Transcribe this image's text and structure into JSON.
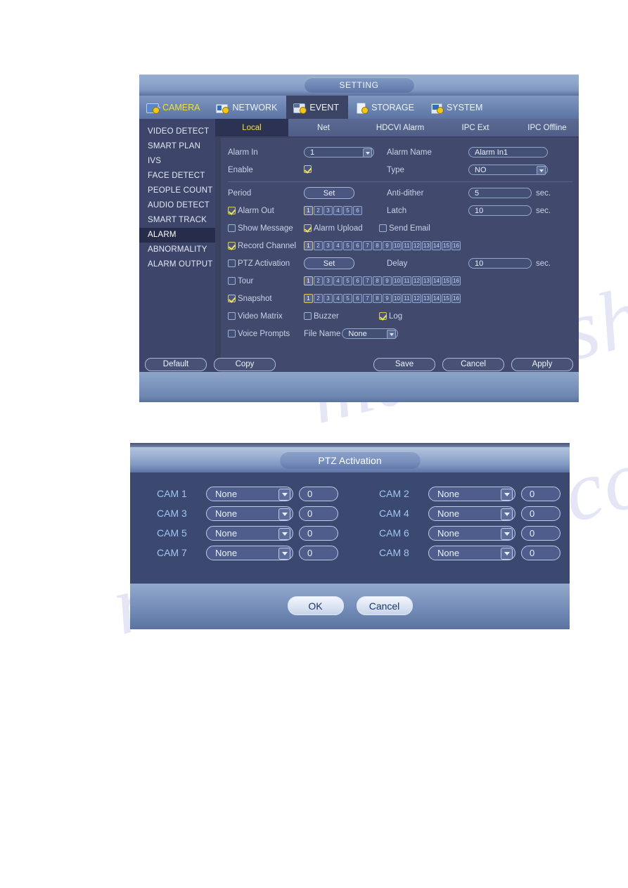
{
  "setting_window": {
    "title": "SETTING",
    "main_tabs": [
      {
        "label": "CAMERA",
        "icon": "camera-icon",
        "state": "hover"
      },
      {
        "label": "NETWORK",
        "icon": "network-icon",
        "state": "normal"
      },
      {
        "label": "EVENT",
        "icon": "event-icon",
        "state": "active"
      },
      {
        "label": "STORAGE",
        "icon": "storage-icon",
        "state": "normal"
      },
      {
        "label": "SYSTEM",
        "icon": "system-icon",
        "state": "normal"
      }
    ],
    "sidebar": {
      "items": [
        {
          "label": "VIDEO DETECT",
          "active": false
        },
        {
          "label": "SMART PLAN",
          "active": false
        },
        {
          "label": "IVS",
          "active": false
        },
        {
          "label": "FACE DETECT",
          "active": false
        },
        {
          "label": "PEOPLE COUNT",
          "active": false
        },
        {
          "label": "AUDIO DETECT",
          "active": false
        },
        {
          "label": "SMART TRACK",
          "active": false
        },
        {
          "label": "ALARM",
          "active": true
        },
        {
          "label": "ABNORMALITY",
          "active": false
        },
        {
          "label": "ALARM OUTPUT",
          "active": false
        }
      ]
    },
    "sub_tabs": [
      {
        "label": "Local",
        "active": true
      },
      {
        "label": "Net",
        "active": false
      },
      {
        "label": "HDCVI Alarm",
        "active": false
      },
      {
        "label": "IPC Ext",
        "active": false
      },
      {
        "label": "IPC Offline",
        "active": false
      }
    ],
    "form": {
      "alarm_in_label": "Alarm In",
      "alarm_in_value": "1",
      "alarm_name_label": "Alarm Name",
      "alarm_name_value": "Alarm In1",
      "enable_label": "Enable",
      "enable_checked": true,
      "type_label": "Type",
      "type_value": "NO",
      "period_label": "Period",
      "period_button": "Set",
      "anti_dither_label": "Anti-dither",
      "anti_dither_value": "5",
      "anti_dither_unit": "sec.",
      "alarm_out_label": "Alarm Out",
      "alarm_out_checked": true,
      "alarm_out_channels": [
        "1",
        "2",
        "3",
        "4",
        "5",
        "6"
      ],
      "alarm_out_selected": [
        "1"
      ],
      "latch_label": "Latch",
      "latch_value": "10",
      "latch_unit": "sec.",
      "show_message_label": "Show Message",
      "show_message_checked": false,
      "alarm_upload_label": "Alarm Upload",
      "alarm_upload_checked": true,
      "send_email_label": "Send Email",
      "send_email_checked": false,
      "record_channel_label": "Record Channel",
      "record_channel_checked": true,
      "record_channels": [
        "1",
        "2",
        "3",
        "4",
        "5",
        "6",
        "7",
        "8",
        "9",
        "10",
        "11",
        "12",
        "13",
        "14",
        "15",
        "16"
      ],
      "record_channels_selected": [
        "1"
      ],
      "ptz_activation_label": "PTZ Activation",
      "ptz_activation_checked": false,
      "ptz_button": "Set",
      "delay_label": "Delay",
      "delay_value": "10",
      "delay_unit": "sec.",
      "tour_label": "Tour",
      "tour_checked": false,
      "tour_channels": [
        "1",
        "2",
        "3",
        "4",
        "5",
        "6",
        "7",
        "8",
        "9",
        "10",
        "11",
        "12",
        "13",
        "14",
        "15",
        "16"
      ],
      "tour_channels_selected": [
        "1"
      ],
      "snapshot_label": "Snapshot",
      "snapshot_checked": true,
      "snapshot_channels": [
        "1",
        "2",
        "3",
        "4",
        "5",
        "6",
        "7",
        "8",
        "9",
        "10",
        "11",
        "12",
        "13",
        "14",
        "15",
        "16"
      ],
      "snapshot_channels_selected": [
        "1"
      ],
      "video_matrix_label": "Video Matrix",
      "video_matrix_checked": false,
      "buzzer_label": "Buzzer",
      "buzzer_checked": false,
      "log_label": "Log",
      "log_checked": true,
      "voice_prompts_label": "Voice Prompts",
      "voice_prompts_checked": false,
      "file_name_label": "File Name",
      "file_name_value": "None"
    },
    "buttons": {
      "default": "Default",
      "copy": "Copy",
      "save": "Save",
      "cancel": "Cancel",
      "apply": "Apply"
    }
  },
  "ptz_window": {
    "title": "PTZ Activation",
    "rows": [
      {
        "left_cam": "CAM 1",
        "left_action": "None",
        "left_value": "0",
        "right_cam": "CAM 2",
        "right_action": "None",
        "right_value": "0"
      },
      {
        "left_cam": "CAM 3",
        "left_action": "None",
        "left_value": "0",
        "right_cam": "CAM 4",
        "right_action": "None",
        "right_value": "0"
      },
      {
        "left_cam": "CAM 5",
        "left_action": "None",
        "left_value": "0",
        "right_cam": "CAM 6",
        "right_action": "None",
        "right_value": "0"
      },
      {
        "left_cam": "CAM 7",
        "left_action": "None",
        "left_value": "0",
        "right_cam": "CAM 8",
        "right_action": "None",
        "right_value": "0"
      }
    ],
    "buttons": {
      "ok": "OK",
      "cancel": "Cancel"
    }
  },
  "watermark": {
    "text1": "manualshive.com",
    "text2": "manualshive.com"
  },
  "colors": {
    "panel_bg": "#3b4260",
    "panel_inner": "#414a6d",
    "sidebar_bg": "#3e456a",
    "sidebar_active": "#262c49",
    "titlebar_top": "#98aed0",
    "accent_yellow": "#f2e03a",
    "checked_yellow": "#e8e258",
    "label_text": "#c6d2e6",
    "cam_label": "#9fc6f2"
  }
}
